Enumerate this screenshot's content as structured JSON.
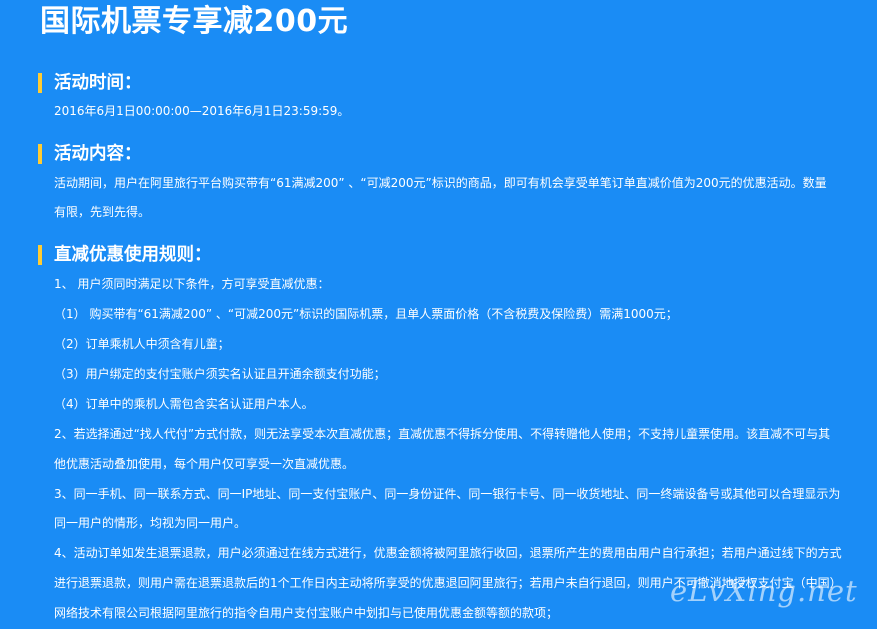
{
  "title": "国际机票专享减200元",
  "sections": [
    {
      "heading": "活动时间：",
      "lines": [
        "2016年6月1日00:00:00—2016年6月1日23:59:59。"
      ]
    },
    {
      "heading": "活动内容：",
      "lines": [
        "活动期间，用户在阿里旅行平台购买带有“61满减200” 、“可减200元”标识的商品，即可有机会享受单笔订单直减价值为200元的优惠活动。数量",
        "有限，先到先得。"
      ]
    },
    {
      "heading": "直减优惠使用规则：",
      "lines": [
        "1、 用户须同时满足以下条件，方可享受直减优惠：",
        "（1） 购买带有“61满减200” 、“可减200元”标识的国际机票，且单人票面价格（不含税费及保险费）需满1000元；",
        "（2）订单乘机人中须含有儿童；",
        "（3）用户绑定的支付宝账户须实名认证且开通余额支付功能；",
        "（4）订单中的乘机人需包含实名认证用户本人。",
        "2、若选择通过“找人代付”方式付款，则无法享受本次直减优惠；直减优惠不得拆分使用、不得转赠他人使用；不支持儿童票使用。该直减不可与其",
        "他优惠活动叠加使用，每个用户仅可享受一次直减优惠。",
        "3、同一手机、同一联系方式、同一IP地址、同一支付宝账户、同一身份证件、同一银行卡号、同一收货地址、同一终端设备号或其他可以合理显示为",
        "同一用户的情形，均视为同一用户。",
        "4、活动订单如发生退票退款，用户必须通过在线方式进行，优惠金额将被阿里旅行收回，退票所产生的费用由用户自行承担；若用户通过线下的方式",
        "进行退票退款，则用户需在退票退款后的1个工作日内主动将所享受的优惠退回阿里旅行；若用户未自行退回，则用户不可撤消地授权支付宝（中国）",
        "网络技术有限公司根据阿里旅行的指令自用户支付宝账户中划扣与已使用优惠金额等额的款项；"
      ]
    }
  ],
  "watermark": "eLvXing.net",
  "colors": {
    "background": "#1a8cf5",
    "text": "#ffffff",
    "heading_bar": "#ffcc33"
  }
}
